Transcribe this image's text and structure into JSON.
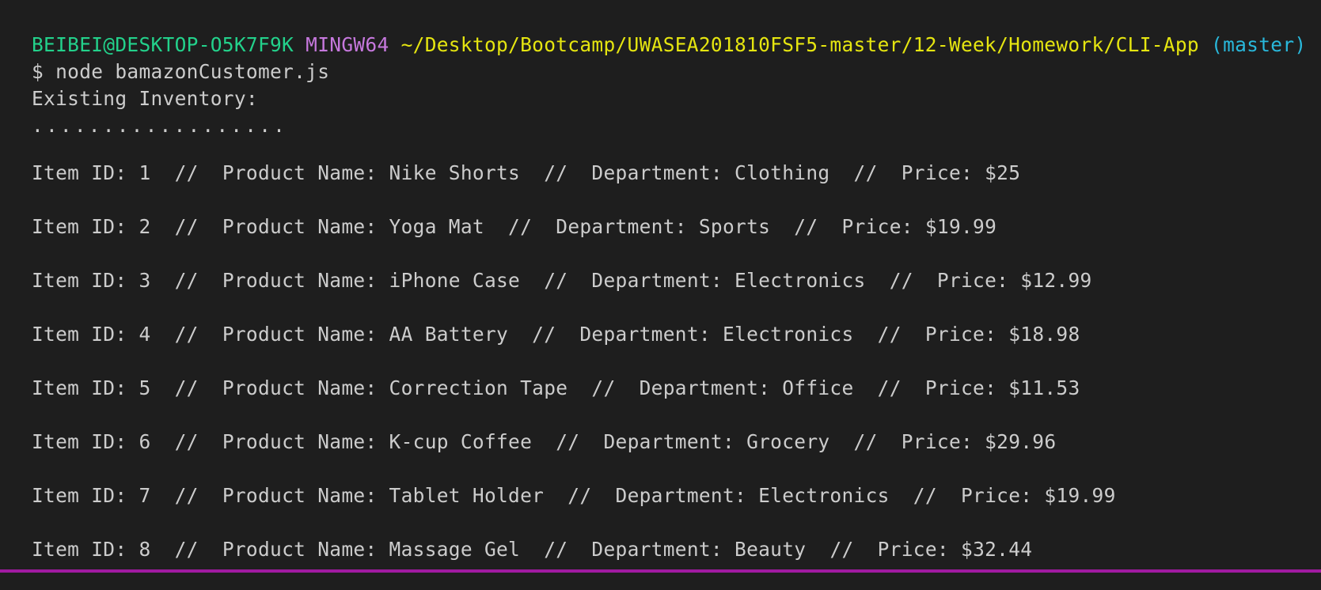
{
  "prompt": {
    "user_host": "BEIBEI@DESKTOP-O5K7F9K",
    "env": "MINGW64",
    "path": "~/Desktop/Bootcamp/UWASEA201810FSF5-master/12-Week/Homework/CLI-App",
    "branch": "(master)"
  },
  "command": "$ node bamazonCustomer.js",
  "heading": "Existing Inventory:",
  "separator": "..................",
  "sep": "  //  ",
  "labels": {
    "item_id": "Item ID: ",
    "product_name": "Product Name: ",
    "department": "Department: ",
    "price": "Price: "
  },
  "items": [
    {
      "id": "1",
      "name": "Nike Shorts",
      "department": "Clothing",
      "price": "$25"
    },
    {
      "id": "2",
      "name": "Yoga Mat",
      "department": "Sports",
      "price": "$19.99"
    },
    {
      "id": "3",
      "name": "iPhone Case",
      "department": "Electronics",
      "price": "$12.99"
    },
    {
      "id": "4",
      "name": "AA Battery",
      "department": "Electronics",
      "price": "$18.98"
    },
    {
      "id": "5",
      "name": "Correction Tape",
      "department": "Office",
      "price": "$11.53"
    },
    {
      "id": "6",
      "name": "K-cup Coffee",
      "department": "Grocery",
      "price": "$29.96"
    },
    {
      "id": "7",
      "name": "Tablet Holder",
      "department": "Electronics",
      "price": "$19.99"
    },
    {
      "id": "8",
      "name": "Massage Gel",
      "department": "Beauty",
      "price": "$32.44"
    }
  ],
  "colors": {
    "background": "#1e1e1e",
    "text": "#cccccc",
    "user_host": "#23d18b",
    "env": "#c678dd",
    "path": "#e5e510",
    "branch": "#29b8db",
    "border": "#a01aa0"
  }
}
